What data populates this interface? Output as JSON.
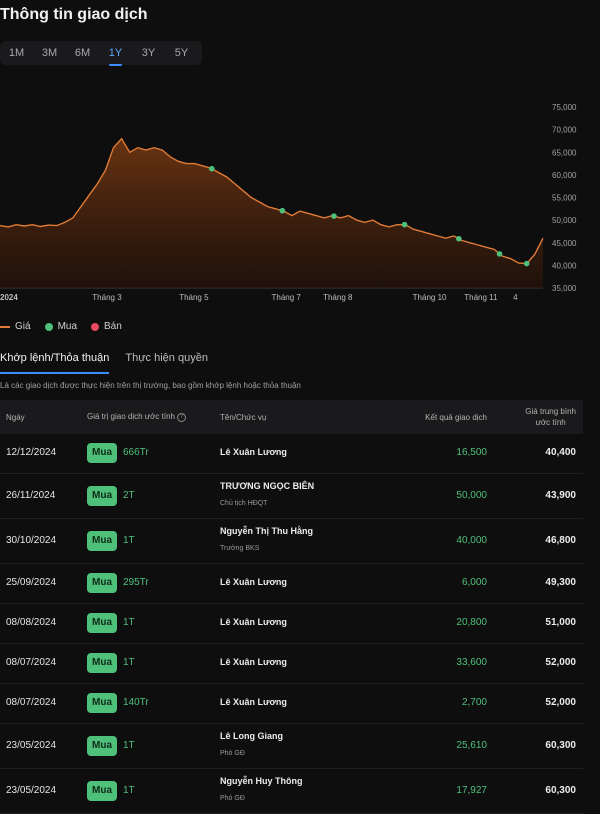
{
  "header": {
    "title": "Thông tin giao dịch"
  },
  "range_tabs": [
    {
      "label": "1M"
    },
    {
      "label": "3M"
    },
    {
      "label": "6M"
    },
    {
      "label": "1Y",
      "active": true
    },
    {
      "label": "3Y"
    },
    {
      "label": "5Y"
    }
  ],
  "chart_data": {
    "type": "area",
    "y_ticks": [
      "75,000",
      "70,000",
      "65,000",
      "60,000",
      "55,000",
      "50,000",
      "45,000",
      "40,000",
      "35,000"
    ],
    "ylim": [
      35000,
      75000
    ],
    "x_labels": [
      "2024",
      "Tháng 3",
      "Tháng 5",
      "Tháng 7",
      "Tháng 8",
      "Tháng 10",
      "Tháng 11",
      "4"
    ],
    "line_color": "#e07b35",
    "price": [
      48800,
      48500,
      49000,
      48700,
      49000,
      48600,
      48900,
      48800,
      49500,
      50500,
      53000,
      55500,
      58000,
      61000,
      66000,
      68000,
      65000,
      66000,
      65500,
      66000,
      65500,
      64000,
      63000,
      62500,
      62500,
      62000,
      61500,
      60500,
      59500,
      58000,
      56500,
      55000,
      54000,
      53000,
      52500,
      52000,
      51000,
      52000,
      51500,
      51000,
      50500,
      51000,
      50500,
      51000,
      50000,
      49500,
      50000,
      49000,
      48500,
      49000,
      49000,
      48000,
      47500,
      47000,
      46500,
      46000,
      46500,
      45500,
      45000,
      44500,
      44000,
      43500,
      42000,
      41500,
      40500,
      40400,
      42500,
      46000
    ],
    "buy_markers": [
      {
        "date": "23/05/2024",
        "price": 60300
      },
      {
        "date": "08/07/2024",
        "price": 52000
      },
      {
        "date": "08/08/2024",
        "price": 51000
      },
      {
        "date": "25/09/2024",
        "price": 49300
      },
      {
        "date": "30/10/2024",
        "price": 46800
      },
      {
        "date": "26/11/2024",
        "price": 43900
      },
      {
        "date": "12/12/2024",
        "price": 40400
      }
    ]
  },
  "legend": [
    {
      "label": "Giá",
      "color": "#e07b35",
      "kind": "line"
    },
    {
      "label": "Mua",
      "color": "#4fc07a",
      "kind": "dot"
    },
    {
      "label": "Bán",
      "color": "#e84a5f",
      "kind": "dot"
    }
  ],
  "tabs": [
    {
      "label": "Khớp lệnh/Thỏa thuận",
      "active": true
    },
    {
      "label": "Thực hiện quyền"
    }
  ],
  "description": "Là các giao dịch được thực hiện trên thị trường, bao gồm khớp lệnh hoặc thỏa thuận",
  "table": {
    "headers": {
      "date": "Ngày",
      "value": "Giá trị giao dịch ước tính",
      "name": "Tên/Chức vụ",
      "result": "Kết quả giao dịch",
      "avg_line1": "Giá trung bình",
      "avg_line2": "ước tính"
    },
    "rows": [
      {
        "date": "12/12/2024",
        "type": "Mua",
        "value": "666Tr",
        "name": "Lê Xuân Lương",
        "role": "",
        "qty": "16,500",
        "avg": "40,400"
      },
      {
        "date": "26/11/2024",
        "type": "Mua",
        "value": "2T",
        "name": "TRƯƠNG NGỌC BIÊN",
        "role": "Chủ tịch HĐQT",
        "qty": "50,000",
        "avg": "43,900"
      },
      {
        "date": "30/10/2024",
        "type": "Mua",
        "value": "1T",
        "name": "Nguyễn Thị Thu Hằng",
        "role": "Trưởng BKS",
        "qty": "40,000",
        "avg": "46,800"
      },
      {
        "date": "25/09/2024",
        "type": "Mua",
        "value": "295Tr",
        "name": "Lê Xuân Lương",
        "role": "",
        "qty": "6,000",
        "avg": "49,300"
      },
      {
        "date": "08/08/2024",
        "type": "Mua",
        "value": "1T",
        "name": "Lê Xuân Lương",
        "role": "",
        "qty": "20,800",
        "avg": "51,000"
      },
      {
        "date": "08/07/2024",
        "type": "Mua",
        "value": "1T",
        "name": "Lê Xuân Lương",
        "role": "",
        "qty": "33,600",
        "avg": "52,000"
      },
      {
        "date": "08/07/2024",
        "type": "Mua",
        "value": "140Tr",
        "name": "Lê Xuân Lương",
        "role": "",
        "qty": "2,700",
        "avg": "52,000"
      },
      {
        "date": "23/05/2024",
        "type": "Mua",
        "value": "1T",
        "name": "Lê Long Giang",
        "role": "Phó GĐ",
        "qty": "25,610",
        "avg": "60,300"
      },
      {
        "date": "23/05/2024",
        "type": "Mua",
        "value": "1T",
        "name": "Nguyễn Huy Thông",
        "role": "Phó GĐ",
        "qty": "17,927",
        "avg": "60,300"
      }
    ]
  }
}
